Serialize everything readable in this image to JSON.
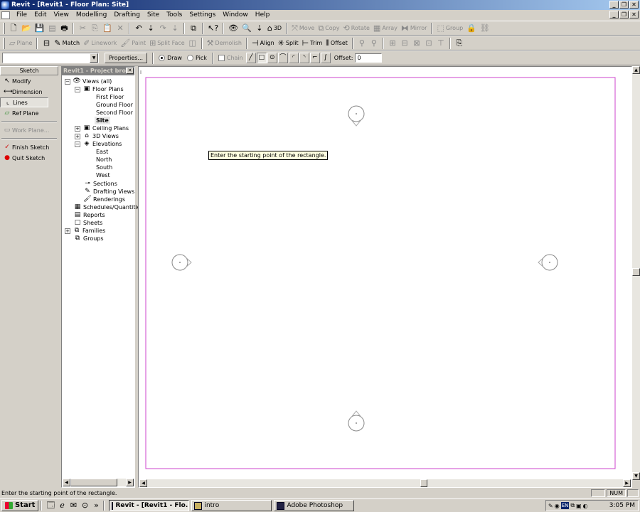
{
  "window": {
    "title": "Revit - [Revit1 - Floor Plan: Site]"
  },
  "menu": [
    "File",
    "Edit",
    "View",
    "Modelling",
    "Drafting",
    "Site",
    "Tools",
    "Settings",
    "Window",
    "Help"
  ],
  "toolbar1": {
    "view_3d_label": "3D",
    "move_label": "Move",
    "copy_label": "Copy",
    "rotate_label": "Rotate",
    "array_label": "Array",
    "mirror_label": "Mirror",
    "group_label": "Group"
  },
  "toolbar2": {
    "plane_label": "Plane",
    "match_label": "Match",
    "linework_label": "Linework",
    "paint_label": "Paint",
    "split_face_label": "Split Face",
    "demolish_label": "Demolish",
    "align_label": "Align",
    "split_label": "Split",
    "trim_label": "Trim",
    "offset_label": "Offset"
  },
  "options_bar": {
    "type_selector_value": "",
    "properties_label": "Properties...",
    "draw_label": "Draw",
    "pick_label": "Pick",
    "draw_selected": true,
    "chain_label": "Chain",
    "offset_label": "Offset:",
    "offset_value": "0"
  },
  "design_bar": {
    "header": "Sketch",
    "items": [
      {
        "label": "Modify"
      },
      {
        "label": "Dimension"
      },
      {
        "label": "Lines"
      },
      {
        "label": "Ref Plane"
      },
      {
        "label": "Work Plane..."
      },
      {
        "label": "Finish Sketch"
      },
      {
        "label": "Quit Sketch"
      }
    ]
  },
  "project_browser": {
    "title": "Revit1 - Project bro...",
    "tree": [
      {
        "label": "Views (all)"
      },
      {
        "label": "Floor Plans"
      },
      {
        "label": "First Floor"
      },
      {
        "label": "Ground Floor"
      },
      {
        "label": "Second Floor"
      },
      {
        "label": "Site"
      },
      {
        "label": "Ceiling Plans"
      },
      {
        "label": "3D Views"
      },
      {
        "label": "Elevations"
      },
      {
        "label": "East"
      },
      {
        "label": "North"
      },
      {
        "label": "South"
      },
      {
        "label": "West"
      },
      {
        "label": "Sections"
      },
      {
        "label": "Drafting Views"
      },
      {
        "label": "Renderings"
      },
      {
        "label": "Schedules/Quantities"
      },
      {
        "label": "Reports"
      },
      {
        "label": "Sheets"
      },
      {
        "label": "Families"
      },
      {
        "label": "Groups"
      }
    ]
  },
  "canvas": {
    "tooltip": "Enter the starting point of the rectangle.",
    "crop_color": "#cc44cc"
  },
  "status": {
    "text": "Enter the starting point of the rectangle.",
    "num": "NUM"
  },
  "taskbar": {
    "start_label": "Start",
    "tasks": [
      {
        "label": "Revit - [Revit1 - Flo..."
      },
      {
        "label": "intro"
      },
      {
        "label": "Adobe Photoshop"
      }
    ],
    "lang": "EN",
    "clock": "3:05 PM"
  }
}
